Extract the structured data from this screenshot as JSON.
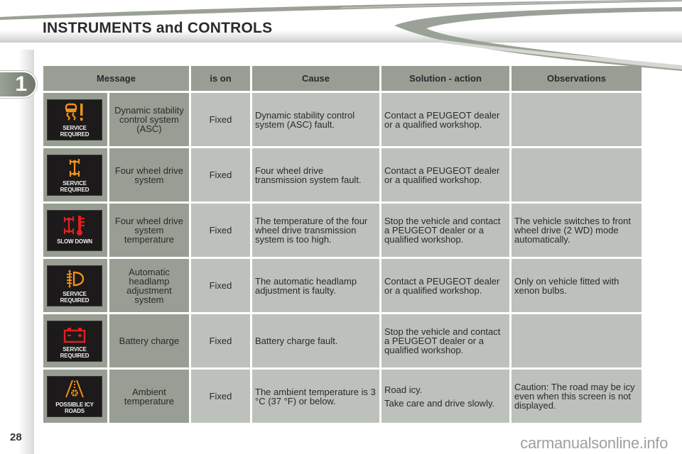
{
  "header": {
    "title": "INSTRUMENTS and CONTROLS"
  },
  "chapter_tab": "1",
  "page_number": "28",
  "watermark": "carmanualsonline.info",
  "colors": {
    "header_cell": "#989e93",
    "body_cell": "#bdc1bb",
    "warning_amber": "#f0901a",
    "warning_red": "#e02020"
  },
  "table": {
    "headers": [
      "Message",
      "is on",
      "Cause",
      "Solution - action",
      "Observations"
    ],
    "rows": [
      {
        "icon": "dynamic-stability-warning-icon",
        "display_label": [
          "SERVICE",
          "REQUIRED"
        ],
        "message": "Dynamic stability control system (ASC)",
        "is_on": "Fixed",
        "cause": "Dynamic stability control system (ASC) fault.",
        "solution": [
          "Contact a PEUGEOT dealer or a qualified workshop."
        ],
        "observations": ""
      },
      {
        "icon": "four-wheel-drive-icon",
        "display_label": [
          "SERVICE",
          "REQUIRED"
        ],
        "message": "Four wheel drive system",
        "is_on": "Fixed",
        "cause": "Four wheel drive transmission system fault.",
        "solution": [
          "Contact a PEUGEOT dealer or a qualified workshop."
        ],
        "observations": ""
      },
      {
        "icon": "four-wheel-drive-temperature-icon",
        "display_label": [
          "SLOW DOWN"
        ],
        "message": "Four wheel drive system temperature",
        "is_on": "Fixed",
        "cause": "The temperature of the four wheel drive transmission system is too high.",
        "solution": [
          "Stop the vehicle and contact a PEUGEOT dealer or a qualified workshop."
        ],
        "observations": "The vehicle switches to front wheel drive (2 WD) mode automatically."
      },
      {
        "icon": "headlamp-adjustment-icon",
        "display_label": [
          "SERVICE",
          "REQUIRED"
        ],
        "message": "Automatic headlamp adjustment system",
        "is_on": "Fixed",
        "cause": "The automatic headlamp adjustment is faulty.",
        "solution": [
          "Contact a PEUGEOT dealer or a qualified workshop."
        ],
        "observations": "Only on vehicle fitted with xenon bulbs."
      },
      {
        "icon": "battery-icon",
        "display_label": [
          "SERVICE",
          "REQUIRED"
        ],
        "message": "Battery charge",
        "is_on": "Fixed",
        "cause": "Battery charge fault.",
        "solution": [
          "Stop the vehicle and contact a PEUGEOT dealer or a qualified workshop."
        ],
        "observations": ""
      },
      {
        "icon": "icy-road-icon",
        "display_label": [
          "POSSIBLE ICY",
          "ROADS"
        ],
        "message": "Ambient temperature",
        "is_on": "Fixed",
        "cause": "The ambient temperature is 3 °C (37 °F) or below.",
        "solution": [
          "Road icy.",
          "Take care and drive slowly."
        ],
        "observations": "Caution: The road may be icy even when this screen is not displayed."
      }
    ]
  }
}
